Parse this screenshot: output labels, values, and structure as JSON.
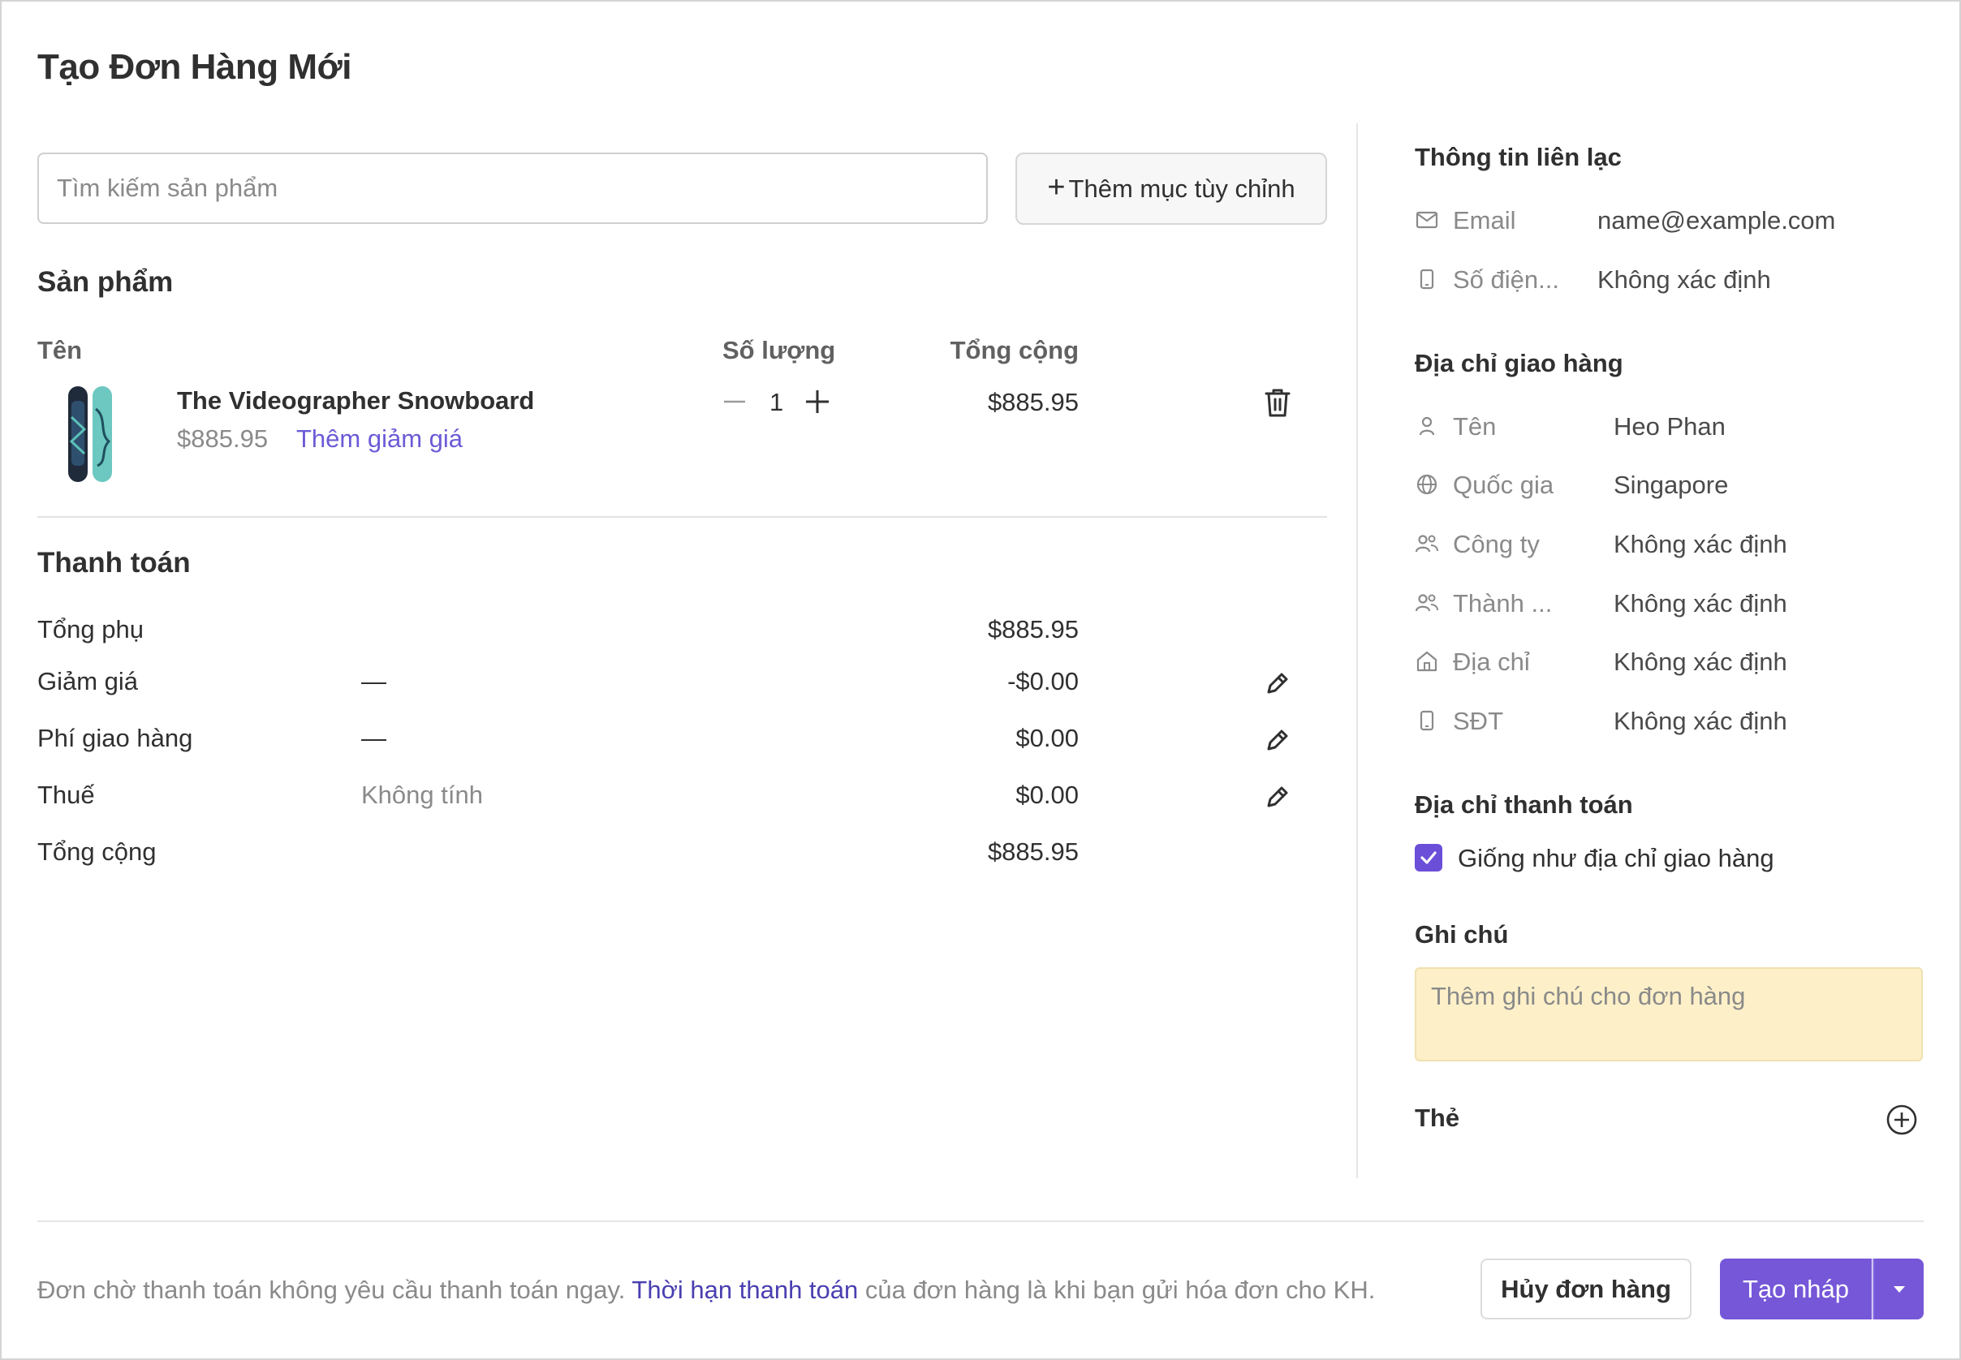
{
  "page": {
    "title": "Tạo Đơn Hàng Mới"
  },
  "search": {
    "placeholder": "Tìm kiếm sản phẩm",
    "value": ""
  },
  "custom_item_button": {
    "icon": "plus-icon",
    "label": "Thêm mục tùy chỉnh"
  },
  "products": {
    "section_title": "Sản phẩm",
    "columns": {
      "name": "Tên",
      "quantity": "Số lượng",
      "total": "Tổng cộng"
    },
    "items": [
      {
        "name": "The Videographer Snowboard",
        "price": "$885.95",
        "discount_link": "Thêm giảm giá",
        "quantity": "1",
        "total": "$885.95",
        "image": "snowboard-thumbnail"
      }
    ]
  },
  "payment": {
    "section_title": "Thanh toán",
    "rows": [
      {
        "label": "Tổng phụ",
        "detail": "",
        "value": "$885.95",
        "editable": false
      },
      {
        "label": "Giảm giá",
        "detail": "—",
        "value": "-$0.00",
        "editable": true
      },
      {
        "label": "Phí giao hàng",
        "detail": "—",
        "value": "$0.00",
        "editable": true
      },
      {
        "label": "Thuế",
        "detail": "Không tính",
        "value": "$0.00",
        "editable": true
      },
      {
        "label": "Tổng cộng",
        "detail": "",
        "value": "$885.95",
        "editable": false
      }
    ]
  },
  "contact": {
    "title": "Thông tin liên lạc",
    "fields": [
      {
        "icon": "mail-icon",
        "label": "Email",
        "value": "name@example.com"
      },
      {
        "icon": "phone-icon",
        "label": "Số điện...",
        "value": "Không xác định"
      }
    ]
  },
  "shipping": {
    "title": "Địa chỉ giao hàng",
    "fields": [
      {
        "icon": "person-icon",
        "label": "Tên",
        "value": "Heo Phan"
      },
      {
        "icon": "globe-icon",
        "label": "Quốc gia",
        "value": "Singapore"
      },
      {
        "icon": "people-icon",
        "label": "Công ty",
        "value": "Không xác định"
      },
      {
        "icon": "people-icon",
        "label": "Thành ...",
        "value": "Không xác định"
      },
      {
        "icon": "home-icon",
        "label": "Địa chỉ",
        "value": "Không xác định"
      },
      {
        "icon": "phone-icon",
        "label": "SĐT",
        "value": "Không xác định"
      }
    ]
  },
  "billing": {
    "title": "Địa chỉ thanh toán",
    "same_as_shipping_label": "Giống như địa chỉ giao hàng",
    "same_as_shipping_checked": true
  },
  "notes": {
    "title": "Ghi chú",
    "placeholder": "Thêm ghi chú cho đơn hàng"
  },
  "tags": {
    "title": "Thẻ"
  },
  "footer": {
    "text_before": "Đơn chờ thanh toán không yêu cầu thanh toán ngay.",
    "link": "Thời hạn thanh toán",
    "text_after": "của đơn hàng là khi bạn gửi hóa đơn cho KH.",
    "cancel_label": "Hủy đơn hàng",
    "draft_label": "Tạo nháp"
  },
  "colors": {
    "accent": "#7557d8",
    "link": "#6b5bd6",
    "note_bg": "#fdf0c8"
  }
}
